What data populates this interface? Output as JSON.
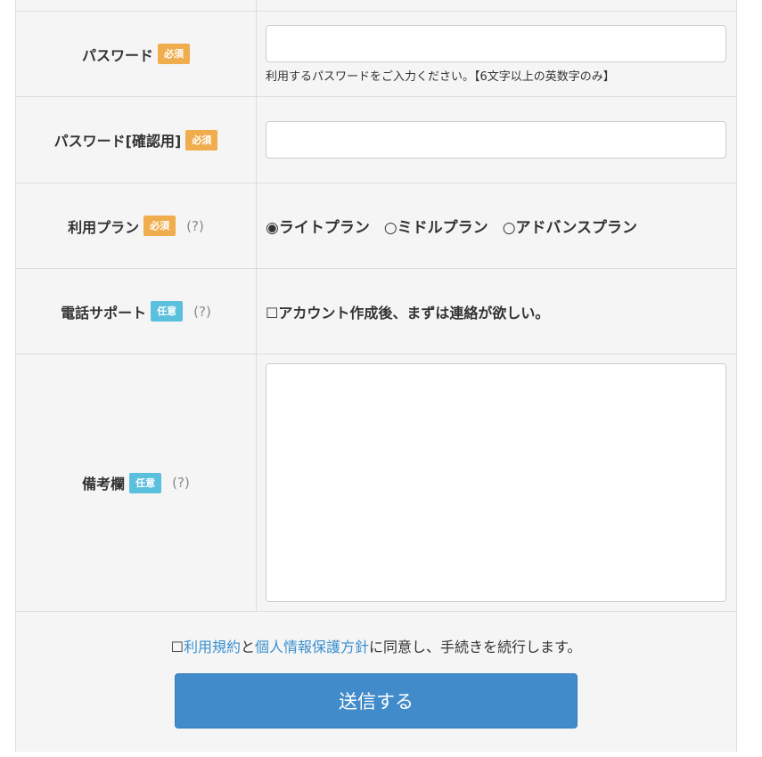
{
  "badges": {
    "required": "必須",
    "optional": "任意"
  },
  "help_label": "(?)",
  "password": {
    "label": "パスワード",
    "value": "",
    "hint": "利用するパスワードをご入力ください。【6文字以上の英数字のみ】"
  },
  "password_confirm": {
    "label": "パスワード[確認用]",
    "value": ""
  },
  "plan": {
    "label": "利用プラン",
    "options": [
      "◉ライトプラン",
      "○ミドルプラン",
      "○アドバンスプラン"
    ],
    "selected": "ライトプラン"
  },
  "phone_support": {
    "label": "電話サポート",
    "checkbox_text": "☐アカウント作成後、まずは連絡が欲しい。",
    "checked": false
  },
  "notes": {
    "label": "備考欄",
    "value": ""
  },
  "agreement": {
    "checkbox": "☐",
    "terms_link": "利用規約",
    "and": "と",
    "privacy_link": "個人情報保護方針",
    "suffix": "に同意し、手続きを続行します。"
  },
  "submit_label": "送信する",
  "colors": {
    "required_badge": "#f0ad4e",
    "optional_badge": "#5bc0de",
    "submit_button": "#428bca",
    "link": "#3a8fcf"
  }
}
